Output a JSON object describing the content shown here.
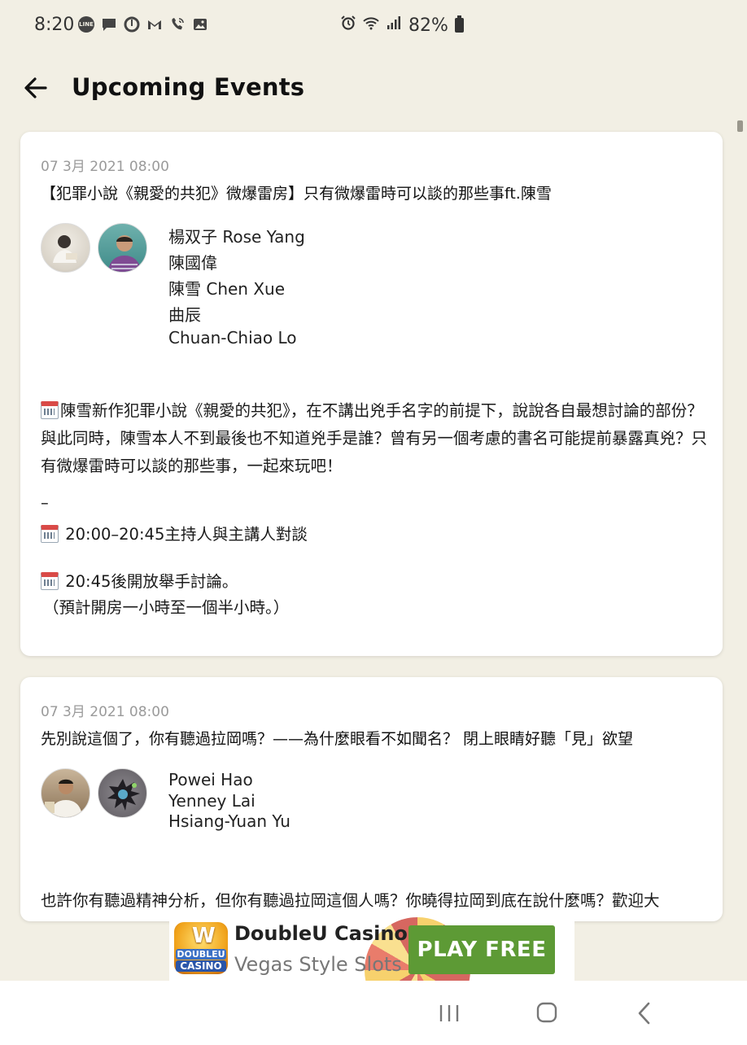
{
  "status_bar": {
    "time": "8:20",
    "app_icons": [
      "line-icon",
      "chat-icon",
      "circle-app-icon",
      "gmail-icon",
      "call-icon",
      "gallery-icon"
    ],
    "line_label": "LINE",
    "battery": "82%"
  },
  "header": {
    "title": "Upcoming Events"
  },
  "events": [
    {
      "date": "07 3月 2021 08:00",
      "title": "【犯罪小說《親愛的共犯》微爆雷房】只有微爆雷時可以談的那些事ft.陳雪",
      "speakers": [
        "楊双子 Rose Yang",
        "陳國偉",
        "陳雪 Chen Xue",
        "曲辰",
        "Chuan-Chiao Lo"
      ],
      "description": "陳雪新作犯罪小說《親愛的共犯》，在不講出兇手名字的前提下，說說各自最想討論的部份？與此同時，陳雪本人不到最後也不知道兇手是誰？曾有另一個考慮的書名可能提前暴露真兇？只有微爆雷時可以談的那些事，一起來玩吧！",
      "separator": "–",
      "schedule_1": "20:00–20:45主持人與主講人對談",
      "schedule_2": "20:45後開放舉手討論。",
      "note": "（預計開房一小時至一個半小時。）"
    },
    {
      "date": "07 3月 2021 08:00",
      "title": "先別說這個了，你有聽過拉岡嗎？——為什麼眼看不如聞名？ 閉上眼睛好聽「見」欲望",
      "speakers": [
        "Powei Hao",
        "Yenney Lai",
        "Hsiang-Yuan Yu"
      ],
      "description": "也許你有聽過精神分析，但你有聽過拉岡這個人嗎？你曉得拉岡到底在說什麼嗎？歡迎大"
    }
  ],
  "ad": {
    "logo_letter": "W",
    "logo_line1": "DOUBLEU",
    "logo_line2": "CASINO",
    "title": "DoubleU Casino",
    "subtitle": "Vegas Style Slots",
    "cta": "PLAY FREE",
    "cta_color": "#5d9a35"
  },
  "colors": {
    "background": "#f2efe4",
    "card": "#ffffff",
    "date_text": "#9a9a9a"
  }
}
